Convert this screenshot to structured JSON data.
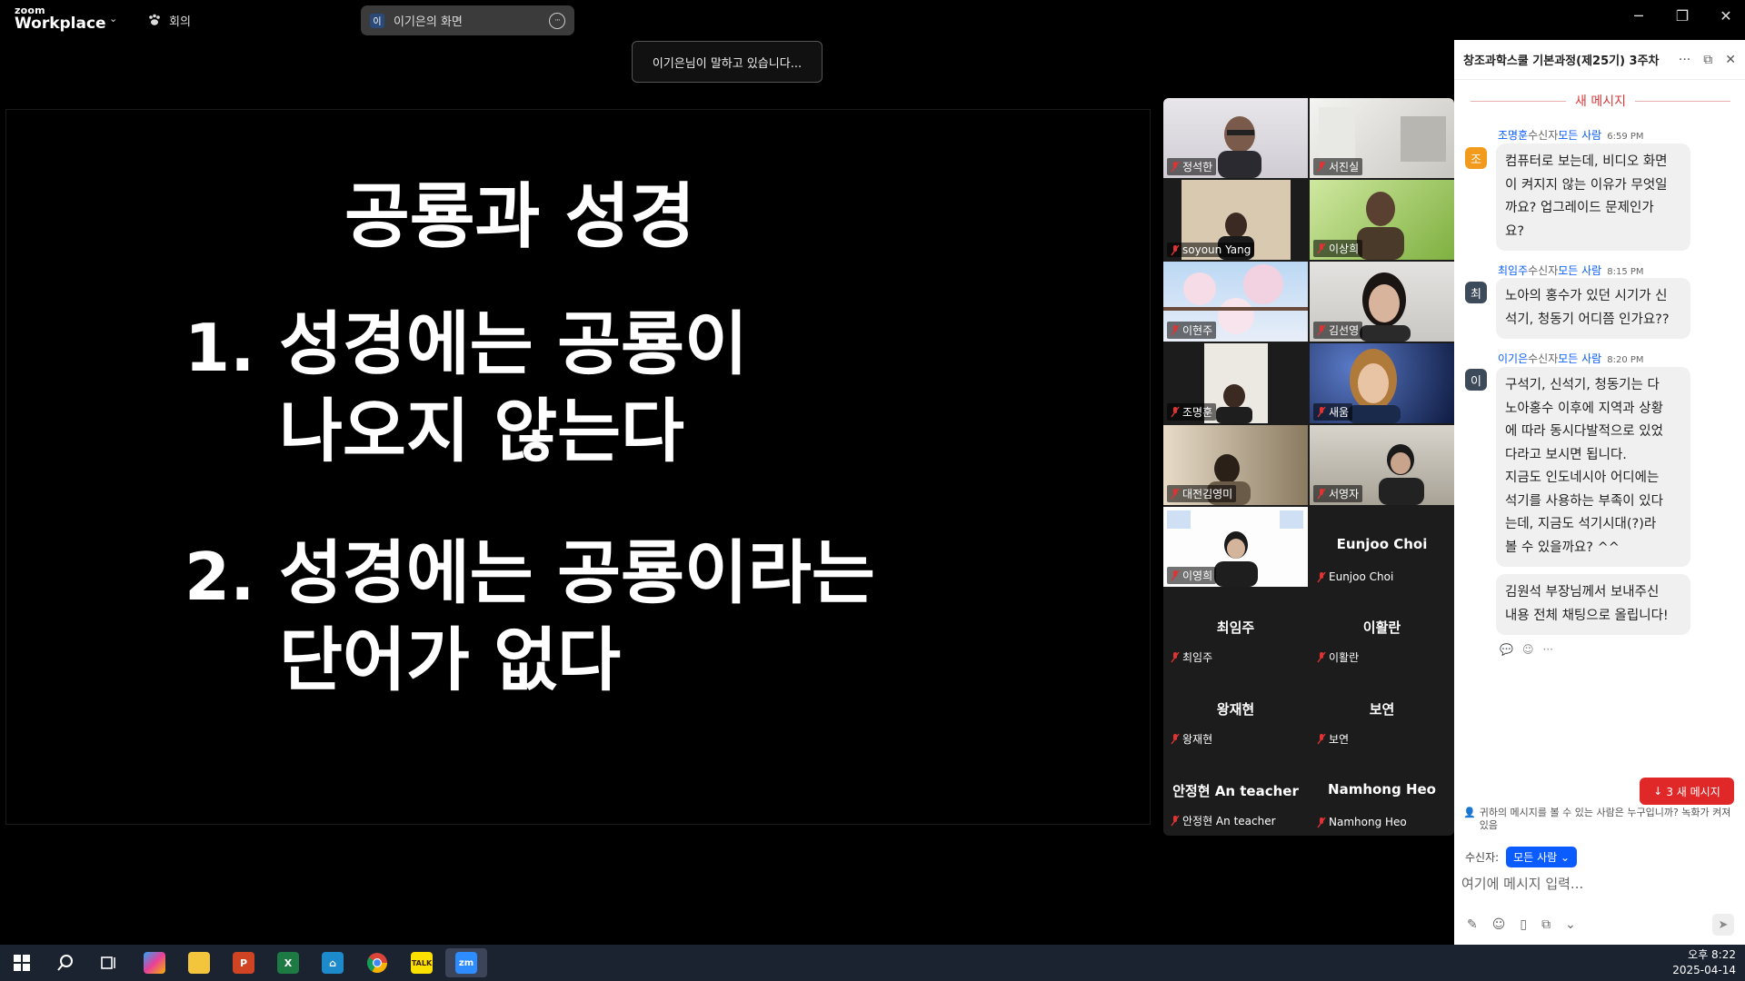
{
  "titlebar": {
    "logo_small": "zoom",
    "logo_big": "Workplace",
    "meeting_label": "회의",
    "share_avatar": "이",
    "share_title": "이기은의 화면",
    "more": "···",
    "minimize": "─",
    "restore": "❐",
    "close": "✕"
  },
  "toast": {
    "text": "이기은님이 말하고 있습니다..."
  },
  "slide": {
    "title": "공룡과 성경",
    "items": [
      {
        "num": "1.",
        "line1": "성경에는 공룡이",
        "line2": "나오지 않는다"
      },
      {
        "num": "2.",
        "line1": "성경에는 공룡이라는",
        "line2": "단어가 없다"
      }
    ]
  },
  "gallery": {
    "tiles": [
      {
        "name": "정석한",
        "video": true
      },
      {
        "name": "서진실",
        "video": true
      },
      {
        "name": "soyoun Yang",
        "video": true
      },
      {
        "name": "이상희",
        "video": true
      },
      {
        "name": "이현주",
        "video": true
      },
      {
        "name": "김선영",
        "video": true
      },
      {
        "name": "조명훈",
        "video": true
      },
      {
        "name": "새움",
        "video": true
      },
      {
        "name": "대전김영미",
        "video": true
      },
      {
        "name": "서영자",
        "video": true
      },
      {
        "name": "이영희",
        "video": true
      },
      {
        "name": "Eunjoo Choi",
        "video": false,
        "display": "Eunjoo Choi"
      },
      {
        "name": "최임주",
        "video": false,
        "display": "최임주"
      },
      {
        "name": "이활란",
        "video": false,
        "display": "이활란"
      },
      {
        "name": "왕재현",
        "video": false,
        "display": "왕재현"
      },
      {
        "name": "보연",
        "video": false,
        "display": "보연"
      },
      {
        "name": "안정현 An teacher",
        "video": false,
        "display": "안정현 An teacher"
      },
      {
        "name": "Namhong Heo",
        "video": false,
        "display": "Namhong Heo"
      }
    ]
  },
  "chat": {
    "title": "창조과학스쿨 기본과정(제25기) 3주차",
    "new_divider": "새 메시지",
    "messages": [
      {
        "sender": "조명훈",
        "mid": "수신자",
        "to": "모든 사람",
        "time": "6:59 PM",
        "avatar": "조",
        "avatar_color": "#f29a1c",
        "lines": [
          "컴퓨터로 보는데, 비디오 화면",
          "이 켜지지 않는 이유가 무엇일",
          "까요? 업그레이드 문제인가",
          "요?"
        ]
      },
      {
        "sender": "최임주",
        "mid": "수신자",
        "to": "모든 사람",
        "time": "8:15 PM",
        "avatar": "최",
        "avatar_color": "#3d4a5a",
        "lines": [
          "노아의 홍수가 있던 시기가 신",
          "석기, 청동기 어디쯤 인가요??"
        ]
      },
      {
        "sender": "이기은",
        "mid": "수신자",
        "to": "모든 사람",
        "time": "8:20 PM",
        "avatar": "이",
        "avatar_color": "#3d4a5a",
        "lines": [
          "구석기, 신석기, 청동기는 다",
          "노아홍수 이후에 지역과 상황",
          "에 따라 동시다발적으로 있었",
          "다라고 보시면 됩니다.",
          "지금도 인도네시아 어디에는",
          "석기를 사용하는 부족이 있다",
          "는데, 지금도 석기시대(?)라",
          "볼 수 있을까요?  ^^"
        ],
        "extra_lines": [
          "김원석 부장님께서 보내주신",
          "내용 전체 채팅으로 올립니다!"
        ]
      }
    ],
    "new_button": "3 새 메시지",
    "privacy": "귀하의 메시지를 볼 수 있는 사람은 누구입니까? 녹화가 켜져 있음",
    "recipient_label": "수신자:",
    "recipient_value": "모든 사람",
    "input_placeholder": "여기에 메시지 입력..."
  },
  "taskbar": {
    "time": "오후 8:22",
    "date": "2025-04-14"
  }
}
